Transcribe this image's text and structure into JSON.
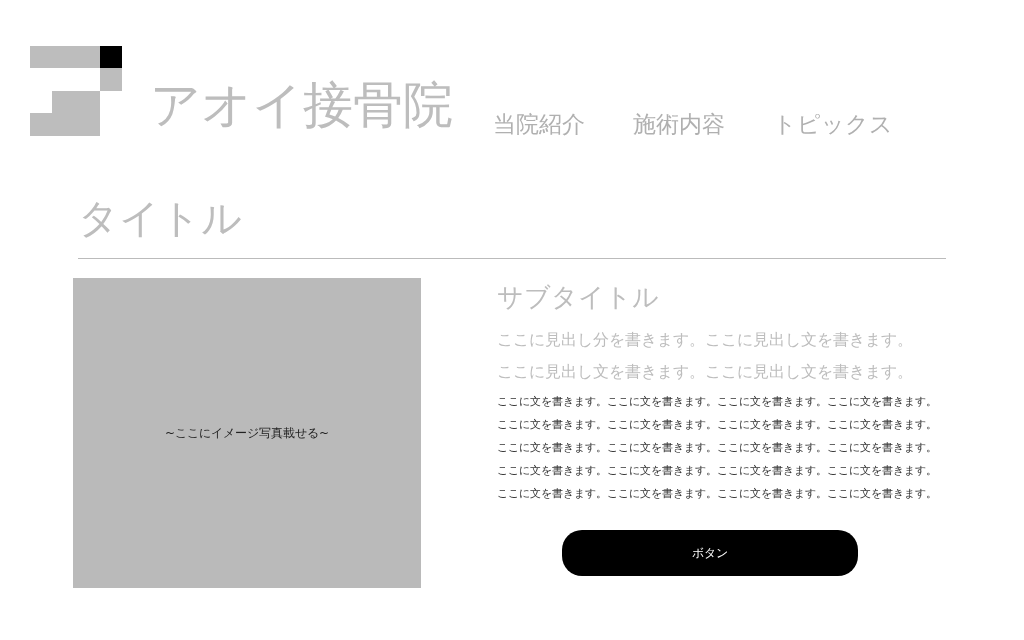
{
  "header": {
    "logo_text": "アオイ接骨院",
    "nav": [
      "当院紹介",
      "施術内容",
      "トピックス"
    ]
  },
  "page_title": "タイトル",
  "image_placeholder": {
    "text": "~ここにイメージ写真載せる~"
  },
  "content": {
    "subtitle": "サブタイトル",
    "headings": [
      "ここに見出し分を書きます。ここに見出し文を書きます。",
      "ここに見出し文を書きます。ここに見出し文を書きます。"
    ],
    "body_lines": [
      "ここに文を書きます。ここに文を書きます。ここに文を書きます。ここに文を書きます。",
      "ここに文を書きます。ここに文を書きます。ここに文を書きます。ここに文を書きます。",
      "ここに文を書きます。ここに文を書きます。ここに文を書きます。ここに文を書きます。",
      "ここに文を書きます。ここに文を書きます。ここに文を書きます。ここに文を書きます。",
      "ここに文を書きます。ここに文を書きます。ここに文を書きます。ここに文を書きます。"
    ],
    "button": "ボタン"
  }
}
